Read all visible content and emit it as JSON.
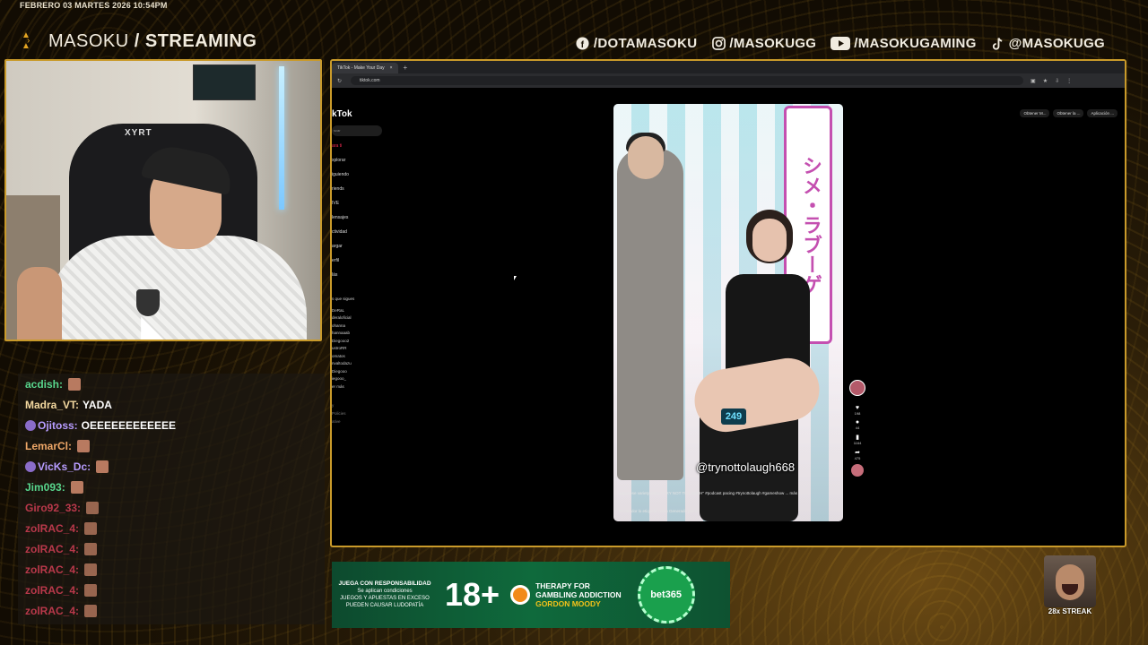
{
  "overlay": {
    "datetime": "FEBRERO 03 MARTES 2026 10:54PM",
    "brand": {
      "name": "MASOKU",
      "slash": "/",
      "section": "STREAMING"
    },
    "socials": [
      {
        "icon": "facebook-icon",
        "handle": "/DOTAMASOKU"
      },
      {
        "icon": "instagram-icon",
        "handle": "/MASOKUGG"
      },
      {
        "icon": "youtube-icon",
        "handle": "/MASOKUGAMING"
      },
      {
        "icon": "tiktok-icon",
        "handle": "@MASOKUGG"
      }
    ],
    "accent": "#c99a2a"
  },
  "webcam": {
    "chair_brand": "XYRT"
  },
  "chat": [
    {
      "user": "acdish:",
      "color": "#58d68d",
      "text": "",
      "badge": false,
      "emote": true
    },
    {
      "user": "Madra_VT:",
      "color": "#f4d9a0",
      "text": "YADA",
      "badge": false,
      "emote": false
    },
    {
      "user": "Ojitoss:",
      "color": "#b79cff",
      "text": "OEEEEEEEEEEEE",
      "badge": true,
      "emote": false
    },
    {
      "user": "LemarCl:",
      "color": "#f0a868",
      "text": "",
      "badge": false,
      "emote": true
    },
    {
      "user": "VicKs_Dc:",
      "color": "#b79cff",
      "text": "",
      "badge": true,
      "emote": true
    },
    {
      "user": "Jim093:",
      "color": "#58d68d",
      "text": "",
      "badge": false,
      "emote": true
    },
    {
      "user": "Giro92_33:",
      "color": "#e0415a",
      "text": "",
      "badge": false,
      "emote": true
    },
    {
      "user": "zolRAC_4:",
      "color": "#e0415a",
      "text": "",
      "badge": false,
      "emote": true
    },
    {
      "user": "zolRAC_4:",
      "color": "#e0415a",
      "text": "",
      "badge": false,
      "emote": true
    },
    {
      "user": "zolRAC_4:",
      "color": "#e0415a",
      "text": "",
      "badge": false,
      "emote": true
    },
    {
      "user": "zolRAC_4:",
      "color": "#e0415a",
      "text": "",
      "badge": false,
      "emote": true
    },
    {
      "user": "zolRAC_4:",
      "color": "#e0415a",
      "text": "",
      "badge": false,
      "emote": true
    }
  ],
  "browser": {
    "tab_title": "TikTok - Make Your Day",
    "tab_add": "+",
    "url": "tiktok.com",
    "get_app_buttons": [
      "Obtener M...",
      "Obtener la ...",
      "Aplicación ..."
    ]
  },
  "tiktok": {
    "logo": "kTok",
    "search_placeholder": "scar",
    "nav": [
      "ara ti",
      "xplorar",
      "iguiendo",
      "riends",
      "IVE",
      "lensajes",
      "ctividad",
      "argar",
      "erfil",
      "lás"
    ],
    "following_title": "s que sigues",
    "following": [
      "DeRaL",
      "deraloficial",
      "ohanna",
      "hannaaab",
      "Diegooo2",
      "ustroRR",
      "omatos",
      "nvaltodazu",
      "Diegooo",
      "iegooo_",
      "er más"
    ],
    "footer": [
      "y",
      "Policies",
      "ative"
    ],
    "video": {
      "sign_text": "シメ・ラブーゲ",
      "display": "249",
      "watermark": "@trynottolaugh668",
      "caption": "Japanese variety show \" TRY NOT TO LAUGH\" #podcast pacing #trynottolaugh #gameshow ... más",
      "ai_note": "El creador lo etiquetó como Generado por IA"
    },
    "actions": [
      {
        "icon": "heart-icon",
        "count": "198"
      },
      {
        "icon": "comment-icon",
        "count": "44"
      },
      {
        "icon": "bookmark-icon",
        "count": "1164"
      },
      {
        "icon": "share-icon",
        "count": "475"
      }
    ]
  },
  "ad": {
    "line1": "JUEGA CON RESPONSABILIDAD",
    "line2": "Se aplican condiciones",
    "line3": "JUEGOS Y APUESTAS EN EXCESO",
    "line4": "PUEDEN CAUSAR LUDOPATÍA",
    "age": "18+",
    "therapy": "THERAPY FOR",
    "therapy2": "GAMBLING ADDICTION",
    "org": "GORDON MOODY",
    "brand": "bet365"
  },
  "streak": {
    "label": "28x STREAK"
  }
}
